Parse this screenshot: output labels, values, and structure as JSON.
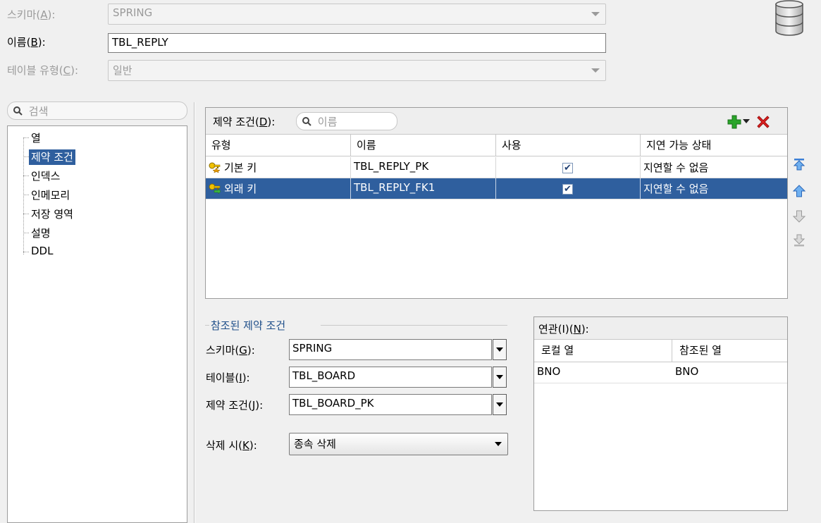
{
  "header": {
    "schema_label": "스키마(",
    "schema_key": "A",
    "schema_tail": "):",
    "schema_value": "SPRING",
    "name_label": "이름(",
    "name_key": "B",
    "name_tail": "):",
    "name_value": "TBL_REPLY",
    "table_type_label": "테이블 유형(",
    "table_type_key": "C",
    "table_type_tail": "):",
    "table_type_value": "일반"
  },
  "sidebar": {
    "search_placeholder": "검색",
    "items": [
      {
        "label": "열"
      },
      {
        "label": "제약 조건",
        "selected": true
      },
      {
        "label": "인덱스"
      },
      {
        "label": "인메모리"
      },
      {
        "label": "저장 영역"
      },
      {
        "label": "설명"
      },
      {
        "label": "DDL"
      }
    ]
  },
  "constraints": {
    "title_label": "제약 조건(",
    "title_key": "D",
    "title_tail": "):",
    "search_placeholder": "이름",
    "columns": [
      "유형",
      "이름",
      "사용",
      "지연 가능 상태"
    ],
    "rows": [
      {
        "type": "기본 키",
        "name": "TBL_REPLY_PK",
        "enabled": "✔",
        "deferrable": "지연할 수 없음",
        "selected": false
      },
      {
        "type": "외래 키",
        "name": "TBL_REPLY_FK1",
        "enabled": "✔",
        "deferrable": "지연할 수 없음",
        "selected": true
      }
    ]
  },
  "referenced": {
    "group_title": "참조된 제약 조건",
    "schema_label": "스키마(",
    "schema_key": "G",
    "schema_tail": "):",
    "schema_value": "SPRING",
    "table_label": "테이블(",
    "table_key": "I",
    "table_tail": "):",
    "table_value": "TBL_BOARD",
    "constraint_label": "제약 조건(",
    "constraint_key": "J",
    "constraint_tail": "):",
    "constraint_value": "TBL_BOARD_PK",
    "on_delete_label": "삭제 시(",
    "on_delete_key": "K",
    "on_delete_tail": "):",
    "on_delete_value": "종속 삭제"
  },
  "association": {
    "title_label": "연관(I)(",
    "title_key": "N",
    "title_tail": "):",
    "columns": [
      "로컬 열",
      "참조된 열"
    ],
    "rows": [
      {
        "local": "BNO",
        "referenced": "BNO"
      }
    ]
  },
  "colors": {
    "selection": "#2f5f9e",
    "add_green": "#2aa52a",
    "delete_red": "#e02020",
    "arrow_blue": "#3b7fd6"
  }
}
